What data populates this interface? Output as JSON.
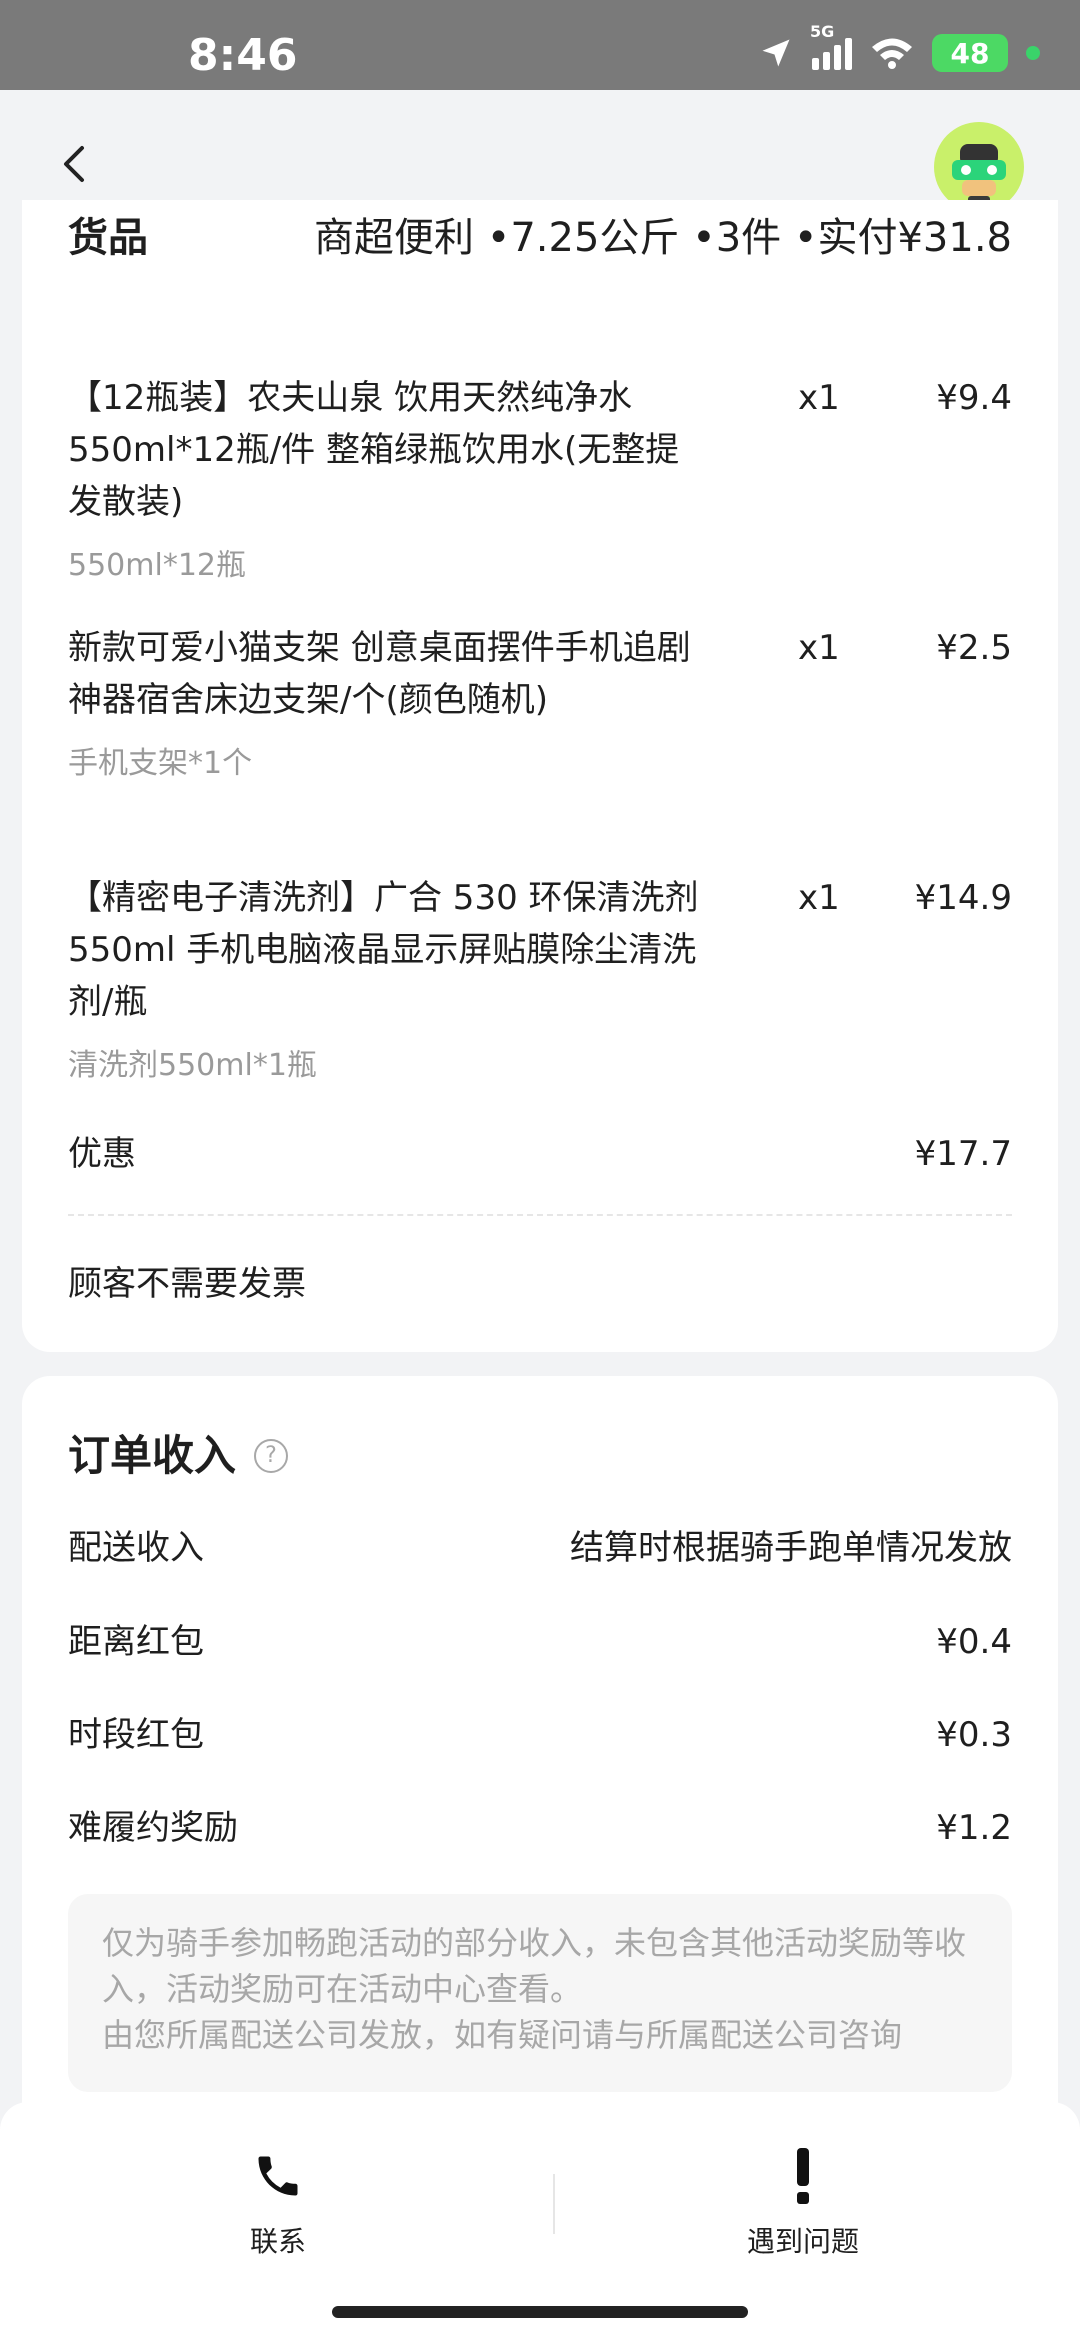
{
  "status_bar": {
    "time": "8:46",
    "network": "5G",
    "battery": "48"
  },
  "goods_card": {
    "header_left": "货品",
    "header_right": "商超便利 •7.25公斤 •3件 •实付¥31.8",
    "items": [
      {
        "name": "【12瓶装】农夫山泉 饮用天然纯净水550ml*12瓶/件 整箱绿瓶饮用水(无整提发散装)",
        "qty": "x1",
        "price": "¥9.4",
        "spec": "550ml*12瓶"
      },
      {
        "name": "新款可爱小猫支架 创意桌面摆件手机追剧神器宿舍床边支架/个(颜色随机)",
        "qty": "x1",
        "price": "¥2.5",
        "spec": "手机支架*1个"
      },
      {
        "name": "【精密电子清洗剂】广合 530 环保清洗剂 550ml 手机电脑液晶显示屏贴膜除尘清洗剂/瓶",
        "qty": "x1",
        "price": "¥14.9",
        "spec": "清洗剂550ml*1瓶"
      }
    ],
    "discount_label": "优惠",
    "discount_value": "¥17.7",
    "invoice_text": "顾客不需要发票"
  },
  "income_card": {
    "title": "订单收入",
    "help_icon": "question-circle-icon",
    "rows": [
      {
        "label": "配送收入",
        "value": "结算时根据骑手跑单情况发放"
      },
      {
        "label": "距离红包",
        "value": "¥0.4"
      },
      {
        "label": "时段红包",
        "value": "¥0.3"
      },
      {
        "label": "难履约奖励",
        "value": "¥1.2"
      }
    ],
    "note_line1": "仅为骑手参加畅跑活动的部分收入，未包含其他活动奖励等收入，活动奖励可在活动中心查看。",
    "note_line2": "由您所属配送公司发放，如有疑问请与所属配送公司咨询"
  },
  "bottom_bar": {
    "contact_label": "联系",
    "problem_label": "遇到问题"
  }
}
